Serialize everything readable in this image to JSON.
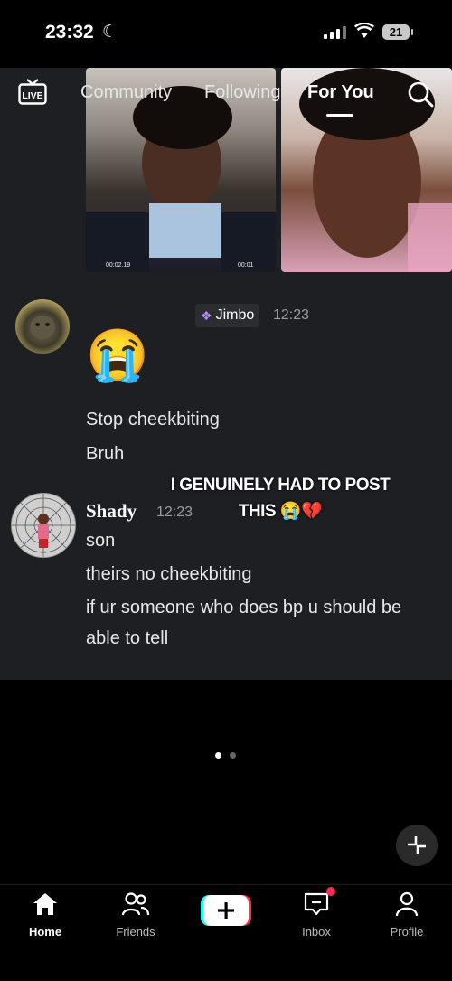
{
  "status_bar": {
    "time": "23:32",
    "battery": "21"
  },
  "top_nav": {
    "tabs": [
      "Community",
      "Following",
      "For You"
    ],
    "active_tab": "For You"
  },
  "video": {
    "timestamp_left": "00:02.19",
    "timestamp_right": "00:01"
  },
  "chat": {
    "message1": {
      "username_tag": "Jimbo",
      "time": "12:23",
      "emoji": "😭",
      "lines": [
        "Stop cheekbiting",
        "Bruh"
      ]
    },
    "message2": {
      "username": "Shady",
      "time": "12:23",
      "lines": [
        "son",
        "theirs no cheekbiting",
        "if ur someone who does bp u should be",
        "able to tell"
      ]
    }
  },
  "overlay_caption": {
    "line1": "I GENUINELY HAD TO POST",
    "line2": "THIS 😭💔"
  },
  "pagination": {
    "count": 2,
    "active": 0
  },
  "bottom_nav": {
    "items": [
      "Home",
      "Friends",
      "Inbox",
      "Profile"
    ],
    "active": "Home"
  },
  "colors": {
    "post_background": "#1e1f22",
    "inbox_badge": "#ff2b55",
    "plus_cyan": "#25f4ee",
    "plus_red": "#fe2c55"
  }
}
